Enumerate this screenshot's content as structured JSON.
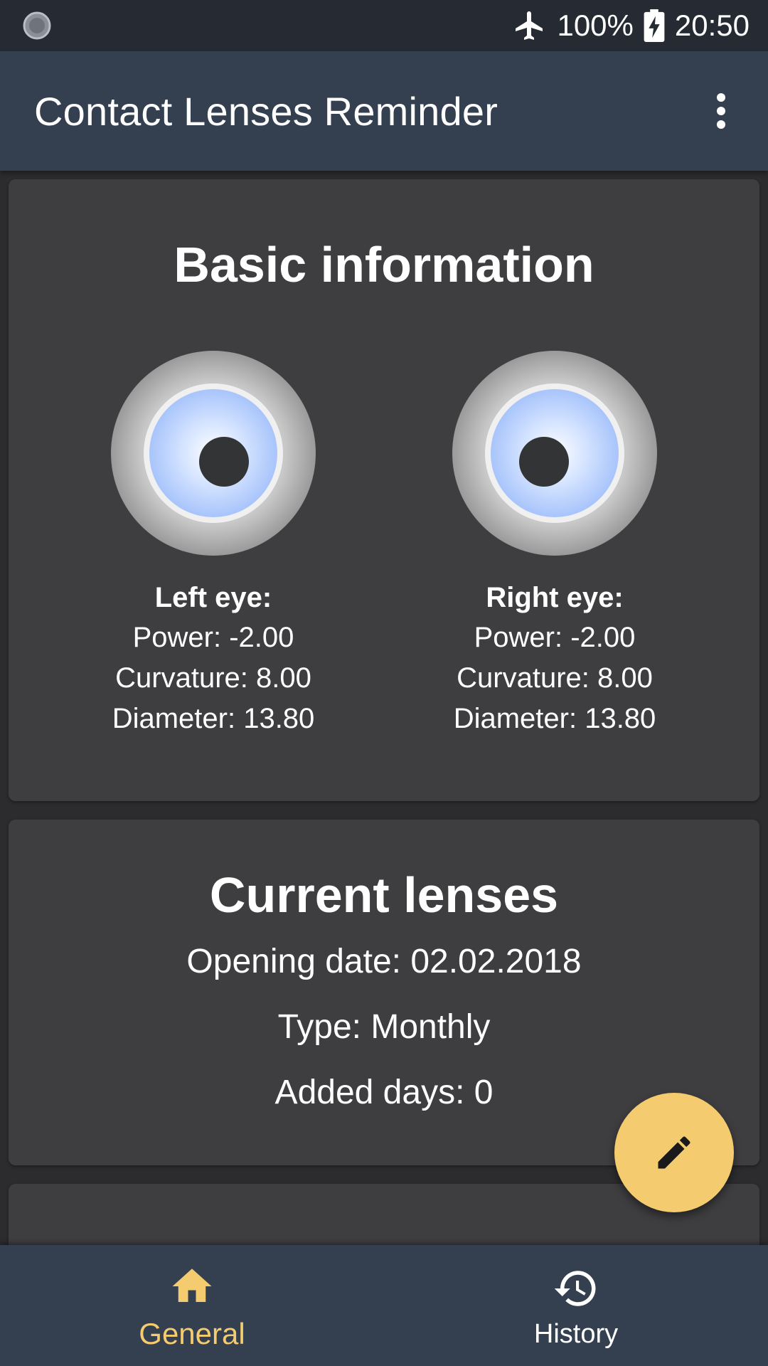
{
  "status_bar": {
    "battery": "100%",
    "time": "20:50"
  },
  "app_bar": {
    "title": "Contact Lenses Reminder"
  },
  "basic_info": {
    "title": "Basic information",
    "left_eye": {
      "label": "Left eye:",
      "power": "Power: -2.00",
      "curvature": "Curvature: 8.00",
      "diameter": "Diameter: 13.80"
    },
    "right_eye": {
      "label": "Right eye:",
      "power": "Power: -2.00",
      "curvature": "Curvature: 8.00",
      "diameter": "Diameter: 13.80"
    }
  },
  "current_lenses": {
    "title": "Current lenses",
    "opening_date": "Opening date: 02.02.2018",
    "type": "Type: Monthly",
    "added_days": "Added days: 0"
  },
  "fab": {
    "icon": "pencil-icon"
  },
  "bottom_nav": {
    "items": [
      {
        "label": "General",
        "icon": "home-icon",
        "active": true
      },
      {
        "label": "History",
        "icon": "history-icon",
        "active": false
      }
    ]
  },
  "colors": {
    "accent": "#f5cb6f",
    "app_bar": "#344050",
    "card": "#3e3e40",
    "background": "#2c2c2e"
  }
}
